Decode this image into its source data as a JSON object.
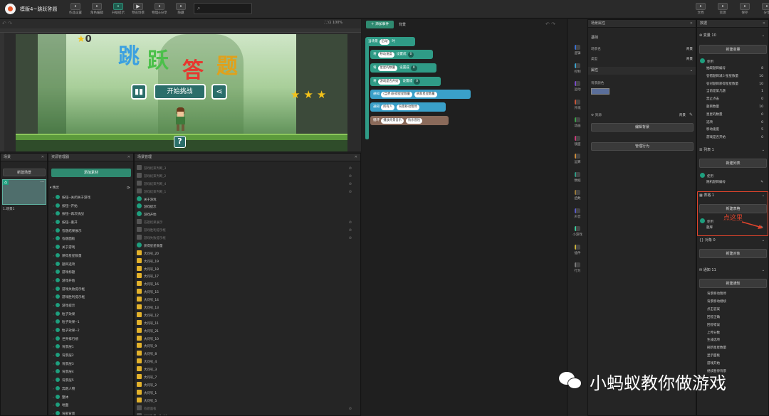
{
  "app": {
    "title": "模版4~跳跃答题"
  },
  "toolbar": {
    "left": [
      {
        "label": "作品设置",
        "icon": "gear-icon"
      },
      {
        "label": "角色编辑",
        "icon": "user-edit-icon"
      },
      {
        "label": "升级提示",
        "icon": "upgrade-icon"
      }
    ],
    "center": [
      {
        "label": "预览场景",
        "icon": "play-icon"
      },
      {
        "label": "物理&分享",
        "icon": "share-icon"
      },
      {
        "label": "隐藏",
        "icon": "list-icon"
      }
    ],
    "right": [
      {
        "label": "文档",
        "icon": "document-icon"
      },
      {
        "label": "资源",
        "icon": "resource-icon"
      },
      {
        "label": "保存",
        "icon": "save-icon"
      },
      {
        "label": "分享",
        "icon": "upload-icon"
      },
      {
        "label": "退出",
        "icon": "exit-icon"
      }
    ]
  },
  "stage": {
    "zoom": "100%",
    "score": "0",
    "title_chars": [
      "跳",
      "跃",
      "答",
      "题"
    ],
    "start_button": "开始挑战",
    "help_mark": "?"
  },
  "scene_panel": {
    "title": "场景",
    "new_button": "新建场景",
    "scene_label": "1.场景1"
  },
  "assets_panel": {
    "title": "资源管理器",
    "add_button": "添加素材",
    "root": "精灵",
    "items": [
      "按钮--关闭关于游戏",
      "按钮--开始",
      "按钮--再次挑战",
      "按钮--重开",
      "答题结果展示",
      "答题面板",
      "关于游戏",
      "获得星星数量",
      "题目选项",
      "游戏标题",
      "游戏开始",
      "游戏失败提示框",
      "游戏胜利提示框",
      "游戏提示",
      "粒子效果",
      "粒子效果--1",
      "粒子效果--2",
      "世界排行榜",
      "背景层1",
      "背景层2",
      "背景层3",
      "背景层4",
      "背景层5",
      "奔跑人物",
      "整体",
      "地面",
      "背部背景"
    ]
  },
  "objects_panel": {
    "title": "场景管理",
    "items": [
      "游戏结束判断_3",
      "游戏结束判断_2",
      "游戏结束判断_4",
      "游戏结束判断_1",
      "关于游戏",
      "游戏提示",
      "游戏开始",
      "答题结果展示",
      "游戏胜利提示框",
      "游戏失败提示框",
      "获得星星数量",
      "大问号_20",
      "大问号_19",
      "大问号_18",
      "大问号_17",
      "大问号_16",
      "大问号_15",
      "大问号_14",
      "大问号_13",
      "大问号_12",
      "大问号_11",
      "大问号_21",
      "大问号_10",
      "大问号_9",
      "大问号_8",
      "大问号_4",
      "大问号_3",
      "大问号_7",
      "大问号_2",
      "大问号_1",
      "大问号_5",
      "答题面板",
      "星星数量--含_19"
    ]
  },
  "events_panel": {
    "add_event": "添加事件",
    "tab": "背景",
    "blocks": [
      {
        "kw": "当场景",
        "p1": "启动",
        "p2": "时"
      },
      {
        "kw": "将",
        "p1": "移动速度",
        "p2": "设置成",
        "n": "0"
      },
      {
        "kw": "将",
        "p1": "星星的数量",
        "p2": "设置成",
        "n": "0"
      },
      {
        "kw": "将",
        "p1": "游戏是否开始",
        "p2": "设置成",
        "n": "0"
      },
      {
        "kw": "通知",
        "p1": "(当界)获得星星数量",
        "p2": "刷新星星数量"
      },
      {
        "kw": "通知",
        "p1": "所有人",
        "p2": "背景移动暂停"
      },
      {
        "kw": "循环",
        "p1": "播放背景音乐",
        "p2": "快乐冒险"
      }
    ]
  },
  "categories": [
    "逻辑",
    "控制",
    "运动",
    "外观",
    "动画",
    "镜面",
    "运算",
    "数据",
    "函数",
    "声音",
    "小游戏",
    "插件",
    "行为"
  ],
  "props_panel": {
    "title": "场景属性",
    "basic": "基础",
    "name_label": "场景名",
    "name_val": "背景",
    "type_label": "类型",
    "type_val": "背景",
    "attr": "属性",
    "bgcolor": "背景颜色",
    "res": "资源",
    "res_val": "背景",
    "edit_bg": "编辑背景",
    "manage": "管理行为"
  },
  "data_panel": {
    "title": "数据",
    "vars_title": "变量 10",
    "new_var": "新建变量",
    "used": "使用",
    "vars": [
      {
        "k": "抽取题目编号",
        "v": "8"
      },
      {
        "k": "答错题目减少星星数量",
        "v": "10"
      },
      {
        "k": "答对题目获得星星数量",
        "v": "10"
      },
      {
        "k": "当前是第几题",
        "v": "1"
      },
      {
        "k": "禁止点击",
        "v": "0"
      },
      {
        "k": "题目数量",
        "v": "10"
      },
      {
        "k": "星星的数量",
        "v": "0"
      },
      {
        "k": "选项",
        "v": "0"
      },
      {
        "k": "移动速度",
        "v": "5"
      },
      {
        "k": "游戏是否开始",
        "v": "0"
      }
    ],
    "lists_title": "列表 1",
    "new_list": "新建列表",
    "list_item": "随机题目编号",
    "tables_title": "表格 1",
    "new_table": "新建表格",
    "table_item": "题库",
    "annotation": "点这里",
    "objs_title": "对象 0",
    "new_obj": "新建对象",
    "notif_title": "通知 11",
    "new_notif": "新建通知",
    "notifs": [
      "背景移动暂停",
      "背景移动继续",
      "点击答案",
      "回答正确",
      "回答错误",
      "上传分数",
      "生成选项",
      "刷新星星数量",
      "显示面板",
      "游戏开始",
      "继续暂停背景"
    ]
  },
  "watermark": "小蚂蚁教你做游戏"
}
